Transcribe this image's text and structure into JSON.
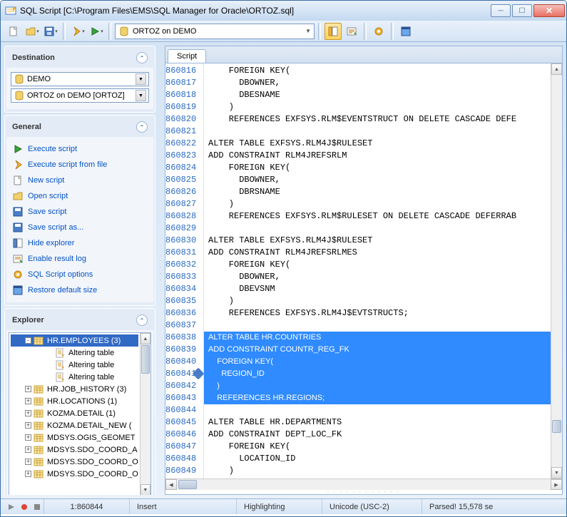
{
  "window": {
    "title": "SQL Script [C:\\Program Files\\EMS\\SQL Manager for Oracle\\ORTOZ.sql]"
  },
  "toolbar": {
    "connection": "ORTOZ on DEMO"
  },
  "destination": {
    "title": "Destination",
    "db": "DEMO",
    "conn": "ORTOZ on DEMO [ORTOZ]"
  },
  "general": {
    "title": "General",
    "items": [
      "Execute script",
      "Execute script from file",
      "New script",
      "Open script",
      "Save script",
      "Save script as...",
      "Hide explorer",
      "Enable result log",
      "SQL Script options",
      "Restore default size"
    ]
  },
  "explorer": {
    "title": "Explorer",
    "items": [
      {
        "level": 1,
        "exp": "-",
        "ic": "tbl",
        "label": "HR.EMPLOYEES (3)",
        "sel": true
      },
      {
        "level": 3,
        "exp": "",
        "ic": "alt",
        "label": "Altering table"
      },
      {
        "level": 3,
        "exp": "",
        "ic": "alt",
        "label": "Altering table"
      },
      {
        "level": 3,
        "exp": "",
        "ic": "alt",
        "label": "Altering table"
      },
      {
        "level": 1,
        "exp": "+",
        "ic": "tbl",
        "label": "HR.JOB_HISTORY (3)"
      },
      {
        "level": 1,
        "exp": "+",
        "ic": "tbl",
        "label": "HR.LOCATIONS (1)"
      },
      {
        "level": 1,
        "exp": "+",
        "ic": "tbl",
        "label": "KOZMA.DETAIL (1)"
      },
      {
        "level": 1,
        "exp": "+",
        "ic": "tbl",
        "label": "KOZMA.DETAIL_NEW ("
      },
      {
        "level": 1,
        "exp": "+",
        "ic": "tbl",
        "label": "MDSYS.OGIS_GEOMET"
      },
      {
        "level": 1,
        "exp": "+",
        "ic": "tbl",
        "label": "MDSYS.SDO_COORD_A"
      },
      {
        "level": 1,
        "exp": "+",
        "ic": "tbl",
        "label": "MDSYS.SDO_COORD_O"
      },
      {
        "level": 1,
        "exp": "+",
        "ic": "tbl",
        "label": "MDSYS.SDO_COORD_O"
      }
    ]
  },
  "script": {
    "tab": "Script",
    "first_line": 860816,
    "marker_line": 860841,
    "lines": [
      "    FOREIGN KEY(",
      "      DBOWNER,",
      "      DBESNAME",
      "    )",
      "    REFERENCES EXFSYS.RLM$EVENTSTRUCT ON DELETE CASCADE DEFE",
      "",
      "ALTER TABLE EXFSYS.RLM4J$RULESET",
      "ADD CONSTRAINT RLM4JREFSRLM",
      "    FOREIGN KEY(",
      "      DBOWNER,",
      "      DBRSNAME",
      "    )",
      "    REFERENCES EXFSYS.RLM$RULESET ON DELETE CASCADE DEFERRAB",
      "",
      "ALTER TABLE EXFSYS.RLM4J$RULESET",
      "ADD CONSTRAINT RLM4JREFSRLMES",
      "    FOREIGN KEY(",
      "      DBOWNER,",
      "      DBEVSNM",
      "    )",
      "    REFERENCES EXFSYS.RLM4J$EVTSTRUCTS;",
      "",
      "ALTER TABLE HR.COUNTRIES",
      "ADD CONSTRAINT COUNTR_REG_FK",
      "    FOREIGN KEY(",
      "      REGION_ID",
      "    )",
      "    REFERENCES HR.REGIONS;",
      "",
      "ALTER TABLE HR.DEPARTMENTS",
      "ADD CONSTRAINT DEPT_LOC_FK",
      "    FOREIGN KEY(",
      "      LOCATION_ID",
      "    )"
    ],
    "sel_start": 22,
    "sel_end": 28
  },
  "status": {
    "pos": "1:860844",
    "mode": "Insert",
    "highlight": "Highlighting",
    "encoding": "Unicode (USC-2)",
    "parsed": "Parsed! 15,578 se"
  }
}
